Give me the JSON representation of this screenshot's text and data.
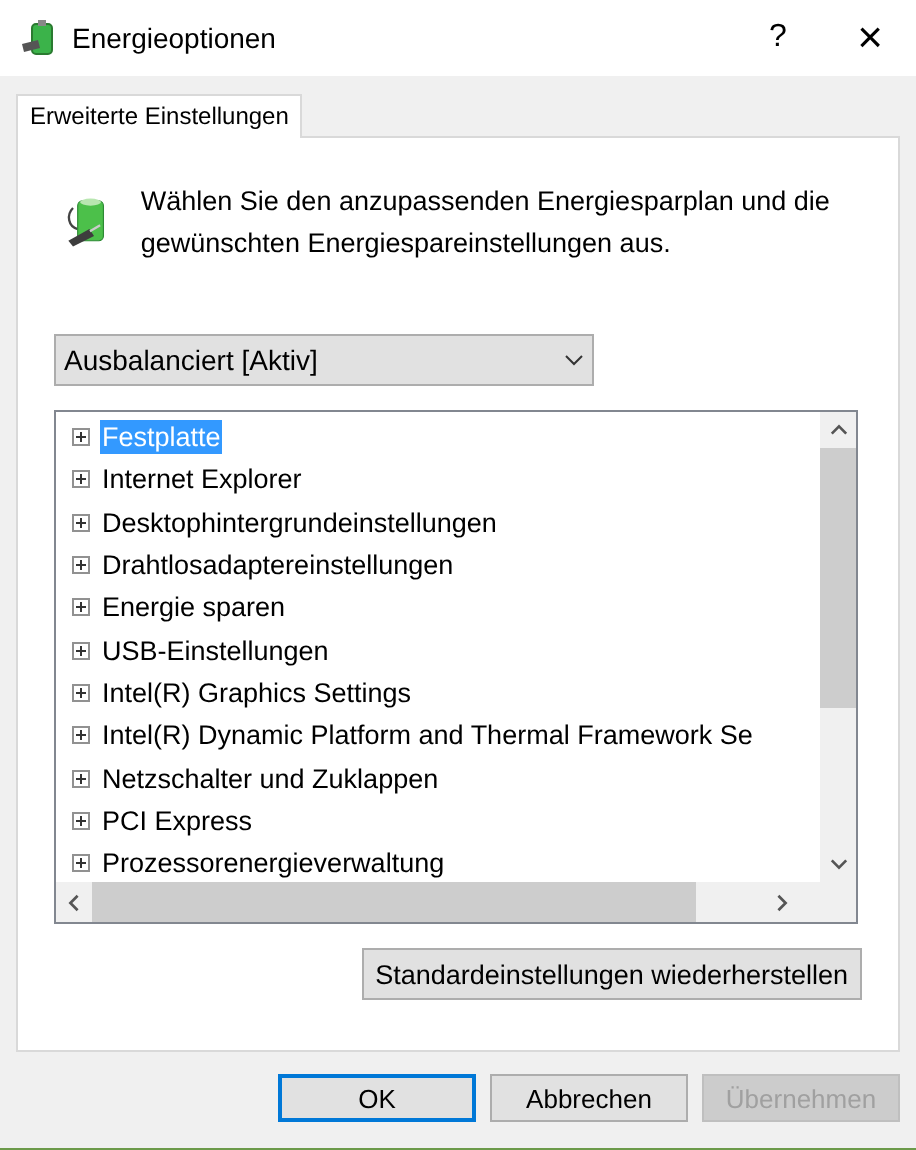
{
  "window": {
    "title": "Energieoptionen",
    "help": "?",
    "close": "×"
  },
  "tabs": [
    {
      "label": "Erweiterte Einstellungen",
      "selected": true
    }
  ],
  "intro": "Wählen Sie den anzupassenden Energiesparplan und die gewünschten Energiespareinstellungen aus.",
  "plan_dropdown": {
    "value": "Ausbalanciert [Aktiv]"
  },
  "tree": [
    {
      "label": "Festplatte",
      "expanded": false,
      "selected": true
    },
    {
      "label": "Internet Explorer",
      "expanded": false,
      "selected": false
    },
    {
      "label": "Desktophintergrundeinstellungen",
      "expanded": false,
      "selected": false
    },
    {
      "label": "Drahtlosadaptereinstellungen",
      "expanded": false,
      "selected": false
    },
    {
      "label": "Energie sparen",
      "expanded": false,
      "selected": false
    },
    {
      "label": "USB-Einstellungen",
      "expanded": false,
      "selected": false
    },
    {
      "label": "Intel(R) Graphics Settings",
      "expanded": false,
      "selected": false
    },
    {
      "label": "Intel(R) Dynamic Platform and Thermal Framework Se",
      "expanded": false,
      "selected": false
    },
    {
      "label": "Netzschalter und Zuklappen",
      "expanded": false,
      "selected": false
    },
    {
      "label": "PCI Express",
      "expanded": false,
      "selected": false
    },
    {
      "label": "Prozessorenergieverwaltung",
      "expanded": false,
      "selected": false
    }
  ],
  "restore_button": "Standardeinstellungen wiederherstellen",
  "buttons": [
    {
      "label": "OK",
      "kind": "default",
      "disabled": false
    },
    {
      "label": "Abbrechen",
      "kind": "normal",
      "disabled": false
    },
    {
      "label": "Übernehmen",
      "kind": "normal",
      "disabled": true
    }
  ]
}
